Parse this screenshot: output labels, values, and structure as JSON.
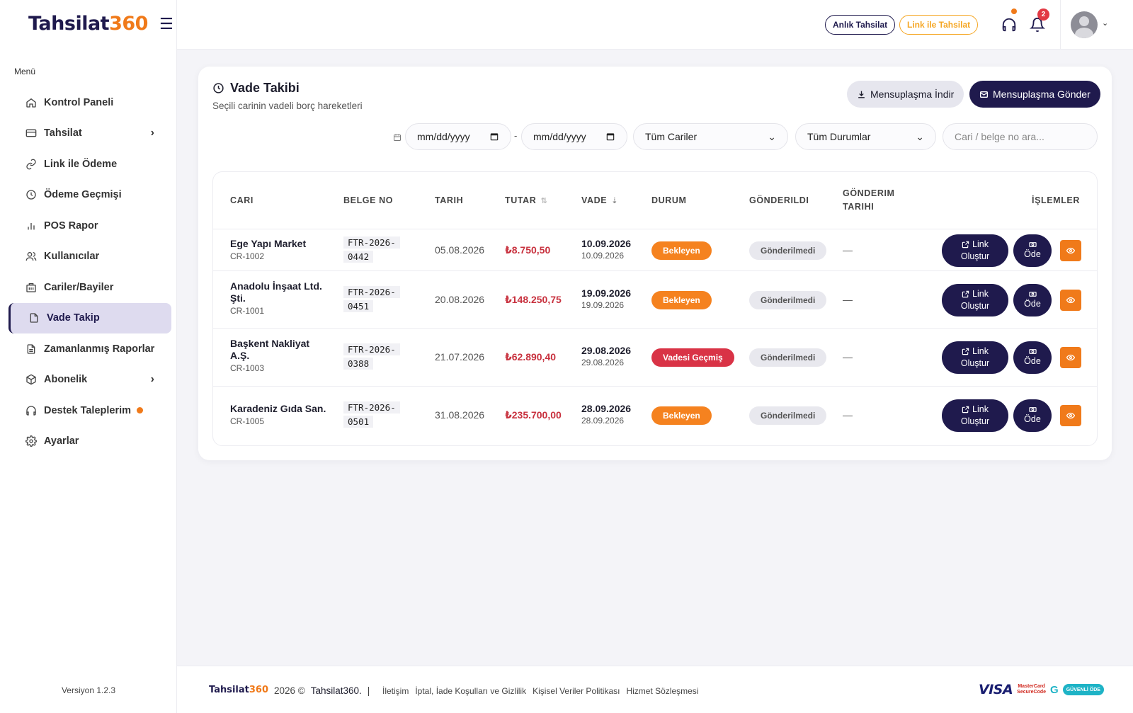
{
  "brand": {
    "logo_main": "Tahsilat",
    "logo_accent": "360"
  },
  "sidebar": {
    "menu_title": "Menü",
    "items": [
      {
        "label": "Kontrol Paneli",
        "icon": "home-icon"
      },
      {
        "label": "Tahsilat",
        "icon": "card-icon",
        "has_submenu": true
      },
      {
        "label": "Link ile Ödeme",
        "icon": "link-icon"
      },
      {
        "label": "Ödeme Geçmişi",
        "icon": "clock-icon"
      },
      {
        "label": "POS Rapor",
        "icon": "bar-chart-icon"
      },
      {
        "label": "Kullanıcılar",
        "icon": "users-icon"
      },
      {
        "label": "Cariler/Bayiler",
        "icon": "building-icon"
      },
      {
        "label": "Vade Takip",
        "icon": "file-icon",
        "active": true
      },
      {
        "label": "Zamanlanmış Raporlar",
        "icon": "report-icon"
      },
      {
        "label": "Abonelik",
        "icon": "box-icon",
        "has_submenu": true
      },
      {
        "label": "Destek Taleplerim",
        "icon": "headset-icon",
        "has_dot": true
      },
      {
        "label": "Ayarlar",
        "icon": "gear-icon"
      }
    ],
    "version": "Versiyon 1.2.3"
  },
  "topbar": {
    "anlik_label": "Anlık Tahsilat",
    "link_label": "Link ile Tahsilat",
    "notification_count": "2"
  },
  "page": {
    "title": "Vade Takibi",
    "subtitle": "Seçili carinin vadeli borç hareketleri",
    "download_label": "Mensuplaşma İndir",
    "send_label": "Mensuplaşma Gönder"
  },
  "filters": {
    "date_from": "mm/dd/yyyy",
    "date_to": "mm/dd/yyyy",
    "date_sep": "-",
    "cari_select": "Tüm Cariler",
    "durum_select": "Tüm Durumlar",
    "search_placeholder": "Cari / belge no ara..."
  },
  "table": {
    "headers": {
      "cari": "CARI",
      "belge": "BELGE NO",
      "tarih": "TARIH",
      "tutar": "TUTAR",
      "vade": "VADE",
      "durum": "DURUM",
      "gonderildi": "GÖNDERILDI",
      "gonderim_line1": "GÖNDERIM",
      "gonderim_line2": "TARIHI",
      "islemler": "İŞLEMLER"
    },
    "action_labels": {
      "link_line1": "Link",
      "link_line2": "Oluştur",
      "ode": "Öde"
    },
    "rows": [
      {
        "cari_line1": "Ege Yapı Market",
        "cari_line2": "",
        "cari_code": "CR-1002",
        "belge_line1": "FTR-2026-",
        "belge_line2": "0442",
        "tarih": "05.08.2026",
        "tutar": "₺8.750,50",
        "vade": "10.09.2026",
        "vade_sub": "10.09.2026",
        "durum": "Bekleyen",
        "durum_color": "#f5821f",
        "gonderildi": "Gönderilmedi",
        "gonderim_tarihi": "—"
      },
      {
        "cari_line1": "Anadolu İnşaat Ltd.",
        "cari_line2": "Şti.",
        "cari_code": "CR-1001",
        "belge_line1": "FTR-2026-",
        "belge_line2": "0451",
        "tarih": "20.08.2026",
        "tutar": "₺148.250,75",
        "vade": "19.09.2026",
        "vade_sub": "19.09.2026",
        "durum": "Bekleyen",
        "durum_color": "#f5821f",
        "gonderildi": "Gönderilmedi",
        "gonderim_tarihi": "—"
      },
      {
        "cari_line1": "Başkent Nakliyat",
        "cari_line2": "A.Ş.",
        "cari_code": "CR-1003",
        "belge_line1": "FTR-2026-",
        "belge_line2": "0388",
        "tarih": "21.07.2026",
        "tutar": "₺62.890,40",
        "vade": "29.08.2026",
        "vade_sub": "29.08.2026",
        "durum": "Vadesi Geçmiş",
        "durum_color": "#d93346",
        "gonderildi": "Gönderilmedi",
        "gonderim_tarihi": "—"
      },
      {
        "cari_line1": "Karadeniz Gıda San.",
        "cari_line2": "",
        "cari_code": "CR-1005",
        "belge_line1": "FTR-2026-",
        "belge_line2": "0501",
        "tarih": "31.08.2026",
        "tutar": "₺235.700,00",
        "vade": "28.09.2026",
        "vade_sub": "28.09.2026",
        "durum": "Bekleyen",
        "durum_color": "#f5821f",
        "gonderildi": "Gönderilmedi",
        "gonderim_tarihi": "—"
      }
    ]
  },
  "footer": {
    "logo_main": "Tahsilat",
    "logo_accent": "360",
    "copyright": "2026 ©",
    "brand_name": "Tahsilat360.",
    "separator": "|",
    "links": [
      "İletişim",
      "İptal, İade Koşulları ve Gizlilik",
      "Kişisel Veriler Politikası",
      "Hizmet Sözleşmesi"
    ],
    "visa": "VISA",
    "mc_line1": "MasterCard",
    "mc_line2": "SecureCode",
    "secure_g": "G",
    "secure_label": "GÜVENLİ ÖDE"
  },
  "colors": {
    "primary": "#1f1a4d",
    "accent": "#f07a1a",
    "danger": "#c8313e"
  }
}
